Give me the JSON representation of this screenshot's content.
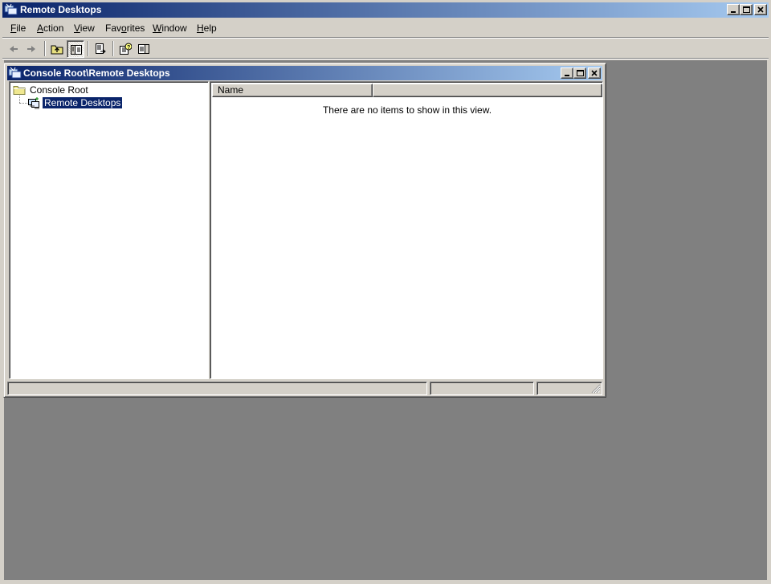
{
  "app": {
    "title": "Remote Desktops",
    "icon": "mmc-console-icon"
  },
  "caption_buttons": {
    "minimize": "minimize-icon",
    "maximize": "maximize-icon",
    "close": "close-icon"
  },
  "menu": {
    "items": [
      {
        "label": "File",
        "accel": "F"
      },
      {
        "label": "Action",
        "accel": "A"
      },
      {
        "label": "View",
        "accel": "V"
      },
      {
        "label": "Favorites",
        "accel": "o"
      },
      {
        "label": "Window",
        "accel": "W"
      },
      {
        "label": "Help",
        "accel": "H"
      }
    ]
  },
  "toolbar": {
    "buttons": [
      {
        "name": "back-button",
        "icon": "back-arrow-icon",
        "enabled": false
      },
      {
        "name": "forward-button",
        "icon": "forward-arrow-icon",
        "enabled": false
      },
      {
        "name": "up-one-level-button",
        "icon": "folder-up-icon",
        "enabled": true
      },
      {
        "name": "show-hide-console-tree-button",
        "icon": "console-tree-icon",
        "enabled": true,
        "pressed": true
      },
      {
        "name": "export-list-button",
        "icon": "export-list-icon",
        "enabled": true
      },
      {
        "name": "help-button",
        "icon": "help-icon",
        "enabled": true
      },
      {
        "name": "show-hide-action-pane-button",
        "icon": "action-pane-icon",
        "enabled": true
      }
    ]
  },
  "child_window": {
    "title": "Console Root\\Remote Desktops"
  },
  "tree": {
    "nodes": [
      {
        "label": "Console Root",
        "icon": "folder-icon",
        "selected": false
      },
      {
        "label": "Remote Desktops",
        "icon": "remote-desktops-icon",
        "selected": true
      }
    ]
  },
  "list": {
    "columns": [
      {
        "label": "Name"
      },
      {
        "label": ""
      }
    ],
    "empty_message": "There are no items to show in this view."
  },
  "colors": {
    "titlebar_start": "#0a246a",
    "titlebar_end": "#a6caf0",
    "face": "#d4d0c8",
    "mdi_background": "#808080",
    "selection": "#0a246a"
  }
}
